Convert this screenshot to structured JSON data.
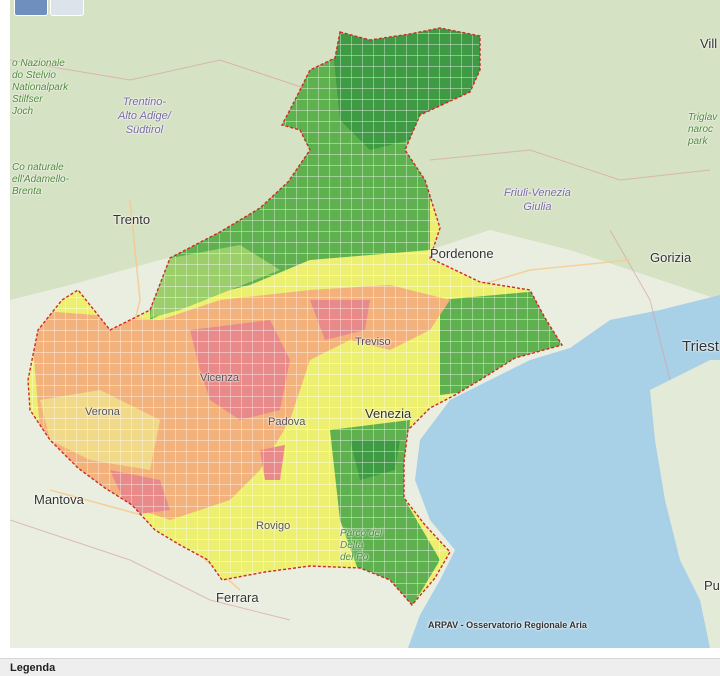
{
  "map": {
    "attribution": "ARPAV - Osservatorio Regionale Aria",
    "places": {
      "stelvio": "o Nazionale\ndo Stelvio\nNationalpark\nStilfser\nJoch",
      "trentino": "Trentino-\nAlto Adige/\nSüdtirol",
      "adamello": "Co naturale\nell'Adamello-\nBrenta",
      "trento": "Trento",
      "friuli": "Friuli-Venezia\nGiulia",
      "pordenone": "Pordenone",
      "gorizia": "Gorizia",
      "trieste": "Triest",
      "triglav": "Triglav\nnaroc\npark",
      "villach": "Vill",
      "treviso": "Treviso",
      "vicenza": "Vicenza",
      "verona": "Verona",
      "padova": "Padova",
      "venezia": "Venezia",
      "mantova": "Mantova",
      "rovigo": "Rovigo",
      "ferrara": "Ferrara",
      "delta": "Parco del\nDelta\ndel Po",
      "pula": "Pu"
    },
    "colors": {
      "sea": "#a8d0e6",
      "land": "#eaeee0",
      "mountain": "#d6e2c4",
      "green_dark": "#3f9a44",
      "green": "#5fb14f",
      "green_light": "#9cce6c",
      "yellow": "#eef06a",
      "orange": "#f3b27c",
      "red": "#e88a8a",
      "border": "#cc2a2a"
    }
  },
  "legend": {
    "title": "Legenda"
  }
}
